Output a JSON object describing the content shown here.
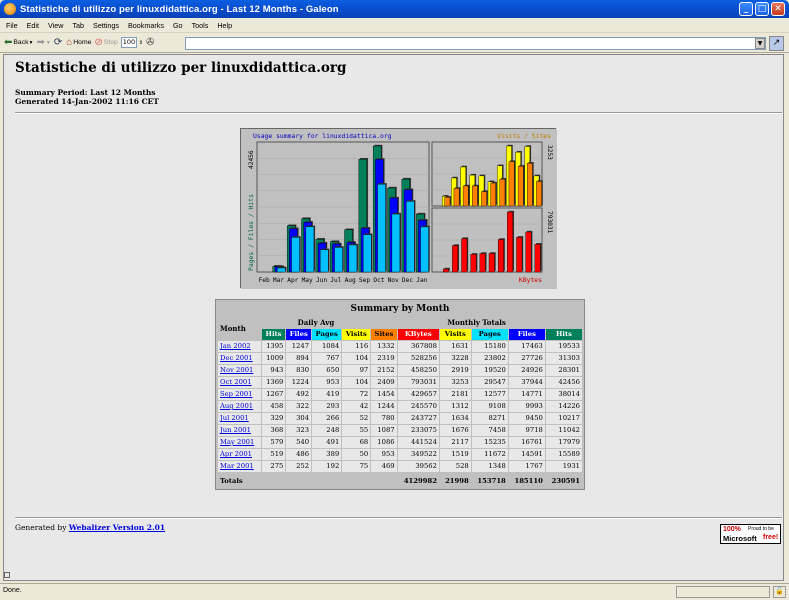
{
  "window": {
    "title": "Statistiche di utilizzo per linuxdidattica.org - Last 12 Months - Galeon",
    "minimize": "_",
    "maximize": "□",
    "close": "✕"
  },
  "menubar": [
    "File",
    "Edit",
    "View",
    "Tab",
    "Settings",
    "Bookmarks",
    "Go",
    "Tools",
    "Help"
  ],
  "toolbar": {
    "back_label": "Back",
    "home_label": "Home",
    "stop_label": "Stop",
    "zoom_value": "100",
    "url_value": ""
  },
  "page": {
    "heading": "Statistiche di utilizzo per linuxdidattica.org",
    "summary_period": "Summary Period: Last 12 Months",
    "generated": "Generated 14-Jan-2002 11:16 CET"
  },
  "chart_data": {
    "type": "bar",
    "title": "Usage summary for linuxdidattica.org",
    "left_axis_label": "Pages / Files / Hits",
    "left_axis_max": "42456",
    "right_top_label": "Visits / Sites",
    "right_top_max": "3253",
    "right_bottom_label": "KBytes",
    "right_bottom_max": "793031",
    "categories": [
      "Feb",
      "Mar",
      "Apr",
      "May",
      "Jun",
      "Jul",
      "Aug",
      "Sep",
      "Oct",
      "Nov",
      "Dec",
      "Jan"
    ],
    "series": [
      {
        "name": "Hits",
        "color": "#00805a",
        "values": [
          0,
          1931,
          15589,
          17979,
          11042,
          10217,
          14226,
          38014,
          42456,
          28301,
          31303,
          19533
        ]
      },
      {
        "name": "Files",
        "color": "#0000ff",
        "values": [
          0,
          1767,
          14591,
          16761,
          9718,
          9450,
          9993,
          14771,
          37944,
          24926,
          27726,
          17463
        ]
      },
      {
        "name": "Pages",
        "color": "#00c0ff",
        "values": [
          0,
          1348,
          11672,
          15235,
          7458,
          8271,
          9108,
          12577,
          29547,
          19520,
          23802,
          15180
        ]
      },
      {
        "name": "Visits",
        "color": "#ffff00",
        "values": [
          0,
          528,
          1519,
          2117,
          1676,
          1634,
          1312,
          2181,
          3253,
          2919,
          3228,
          1631
        ]
      },
      {
        "name": "Sites",
        "color": "#ff8000",
        "values": [
          0,
          469,
          953,
          1086,
          1087,
          780,
          1244,
          1454,
          2409,
          2152,
          2319,
          1332
        ]
      },
      {
        "name": "KBytes",
        "color": "#ff0000",
        "values": [
          0,
          39562,
          349522,
          441524,
          233075,
          243727,
          245570,
          429657,
          793031,
          458250,
          528256,
          367808
        ]
      }
    ]
  },
  "summary": {
    "caption": "Summary by Month",
    "month_header": "Month",
    "daily_avg_header": "Daily Avg",
    "monthly_totals_header": "Monthly Totals",
    "daily_cols": [
      {
        "label": "Hits",
        "color": "#00805a",
        "text": "#ffffff"
      },
      {
        "label": "Files",
        "color": "#0000ff",
        "text": "#ffffff"
      },
      {
        "label": "Pages",
        "color": "#00e0ff",
        "text": "#000000"
      },
      {
        "label": "Visits",
        "color": "#ffff00",
        "text": "#000000"
      }
    ],
    "monthly_cols": [
      {
        "label": "Sites",
        "color": "#ff8000",
        "text": "#000000"
      },
      {
        "label": "KBytes",
        "color": "#ff0000",
        "text": "#ffffff"
      },
      {
        "label": "Visits",
        "color": "#ffff00",
        "text": "#000000"
      },
      {
        "label": "Pages",
        "color": "#00e0ff",
        "text": "#000000"
      },
      {
        "label": "Files",
        "color": "#0000ff",
        "text": "#ffffff"
      },
      {
        "label": "Hits",
        "color": "#00805a",
        "text": "#ffffff"
      }
    ],
    "rows": [
      [
        "Jan 2002",
        "1395",
        "1247",
        "1084",
        "116",
        "1332",
        "367808",
        "1631",
        "15180",
        "17463",
        "19533"
      ],
      [
        "Dec 2001",
        "1009",
        "894",
        "767",
        "104",
        "2319",
        "528256",
        "3228",
        "23802",
        "27726",
        "31303"
      ],
      [
        "Nov 2001",
        "943",
        "830",
        "650",
        "97",
        "2152",
        "458250",
        "2919",
        "19520",
        "24926",
        "28301"
      ],
      [
        "Oct 2001",
        "1369",
        "1224",
        "953",
        "104",
        "2409",
        "793031",
        "3253",
        "29547",
        "37944",
        "42456"
      ],
      [
        "Sep 2001",
        "1267",
        "492",
        "419",
        "72",
        "1454",
        "429657",
        "2181",
        "12577",
        "14771",
        "38014"
      ],
      [
        "Aug 2001",
        "458",
        "322",
        "293",
        "42",
        "1244",
        "245570",
        "1312",
        "9108",
        "9993",
        "14226"
      ],
      [
        "Jul 2001",
        "329",
        "304",
        "266",
        "52",
        "780",
        "243727",
        "1634",
        "8271",
        "9450",
        "10217"
      ],
      [
        "Jun 2001",
        "368",
        "323",
        "248",
        "55",
        "1087",
        "233075",
        "1676",
        "7458",
        "9718",
        "11042"
      ],
      [
        "May 2001",
        "579",
        "540",
        "491",
        "68",
        "1086",
        "441524",
        "2117",
        "15235",
        "16761",
        "17979"
      ],
      [
        "Apr 2001",
        "519",
        "486",
        "389",
        "50",
        "953",
        "349522",
        "1519",
        "11672",
        "14591",
        "15589"
      ],
      [
        "Mar 2001",
        "275",
        "252",
        "192",
        "75",
        "469",
        "39562",
        "528",
        "1348",
        "1767",
        "1931"
      ]
    ],
    "totals_label": "Totals",
    "totals": [
      "4129982",
      "21998",
      "153718",
      "185110",
      "230591"
    ]
  },
  "footer": {
    "generated_by": "Generated by",
    "link_text": "Webalizer Version 2.01",
    "badge_pct": "100%",
    "badge_proud": "Proud to be",
    "badge_ms": "Microsoft",
    "badge_free": "free!"
  },
  "status": {
    "text": "Done."
  }
}
